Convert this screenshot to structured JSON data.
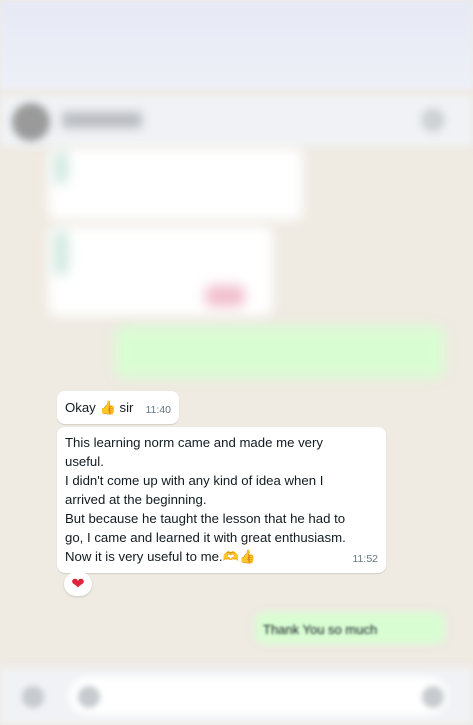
{
  "messages": [
    {
      "text": "Okay 👍 sir",
      "time": "11:40"
    },
    {
      "text": "This learning norm came and made me very useful.\nI didn't come up with any kind of idea when I arrived at the beginning.\nBut because he taught the lesson that he had to go, I came and learned it with great enthusiasm.\nNow it is very useful to me.🫶👍",
      "time": "11:52",
      "reaction": "❤"
    }
  ],
  "sent_reply": {
    "text": "Thank You so much"
  }
}
